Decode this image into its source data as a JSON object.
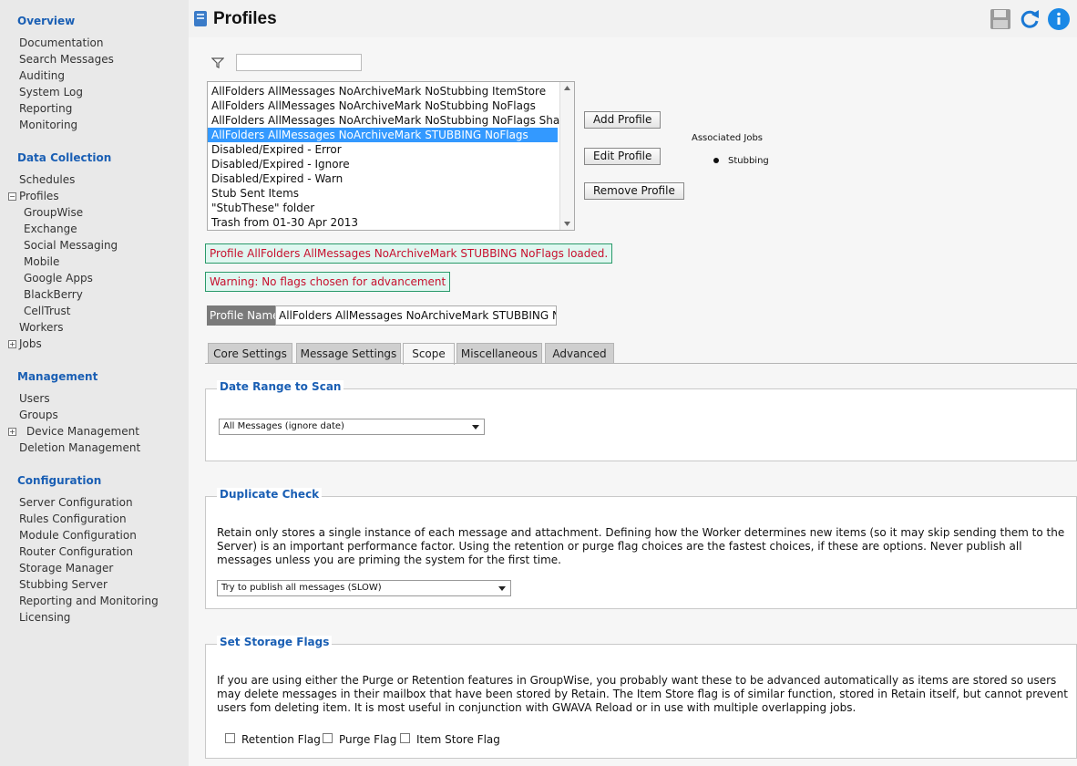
{
  "sidebar": {
    "overview": "Overview",
    "overview_items": [
      "Documentation",
      "Search Messages",
      "Auditing",
      "System Log",
      "Reporting",
      "Monitoring"
    ],
    "data_collection": "Data Collection",
    "schedules": "Schedules",
    "profiles": "Profiles",
    "profile_sub": [
      "GroupWise",
      "Exchange",
      "Social Messaging",
      "Mobile",
      "Google Apps",
      "BlackBerry",
      "CellTrust"
    ],
    "workers": "Workers",
    "jobs": "Jobs",
    "management": "Management",
    "management_items": [
      "Users",
      "Groups"
    ],
    "device_management": "Device Management",
    "deletion_management": "Deletion Management",
    "configuration": "Configuration",
    "configuration_items": [
      "Server Configuration",
      "Rules Configuration",
      "Module Configuration",
      "Router Configuration",
      "Storage Manager",
      "Stubbing Server",
      "Reporting and Monitoring",
      "Licensing"
    ]
  },
  "header": {
    "title": "Profiles"
  },
  "filter": {
    "value": ""
  },
  "profiles_list": {
    "items": [
      "AllFolders AllMessages NoArchiveMark NoStubbing ItemStore",
      "AllFolders AllMessages NoArchiveMark NoStubbing NoFlags",
      "AllFolders AllMessages NoArchiveMark NoStubbing NoFlags Shared",
      "AllFolders AllMessages NoArchiveMark STUBBING NoFlags",
      "Disabled/Expired - Error",
      "Disabled/Expired - Ignore",
      "Disabled/Expired - Warn",
      "Stub Sent Items",
      "\"StubThese\" folder",
      "Trash from 01-30 Apr 2013"
    ],
    "selected_index": 3
  },
  "buttons": {
    "add": "Add Profile",
    "edit": "Edit Profile",
    "remove": "Remove Profile"
  },
  "associated_jobs": {
    "title": "Associated Jobs",
    "jobs": [
      "Stubbing"
    ]
  },
  "messages": {
    "loaded": "Profile AllFolders AllMessages NoArchiveMark STUBBING NoFlags loaded.",
    "warning": "Warning: No flags chosen for advancement"
  },
  "profile_name": {
    "label": "Profile Name",
    "value": "AllFolders AllMessages NoArchiveMark STUBBING NoFlags"
  },
  "tabs": [
    "Core Settings",
    "Message Settings",
    "Scope",
    "Miscellaneous",
    "Advanced"
  ],
  "active_tab": "Scope",
  "date_range": {
    "title": "Date Range to Scan",
    "selected": "All Messages (ignore date)"
  },
  "duplicate": {
    "title": "Duplicate Check",
    "text": "Retain only stores a single instance of each message and attachment. Defining how the Worker determines new items (so it may skip sending them to the Server) is an important performance factor. Using the retention or purge flag choices are the fastest choices, if these are options. Never publish all messages unless you are priming the system for the first time.",
    "selected": "Try to publish all messages (SLOW)"
  },
  "storage_flags": {
    "title": "Set Storage Flags",
    "text": "If you are using either the Purge or Retention features in GroupWise, you probably want these to be advanced automatically as items are stored so users may delete messages in their mailbox that have been stored by Retain. The Item Store flag is of similar function, stored in Retain itself, but cannot prevent users fom deleting item. It is most useful in conjunction with GWAVA Reload or in use with multiple overlapping jobs.",
    "retention": "Retention Flag",
    "purge": "Purge Flag",
    "item_store": "Item Store Flag"
  }
}
